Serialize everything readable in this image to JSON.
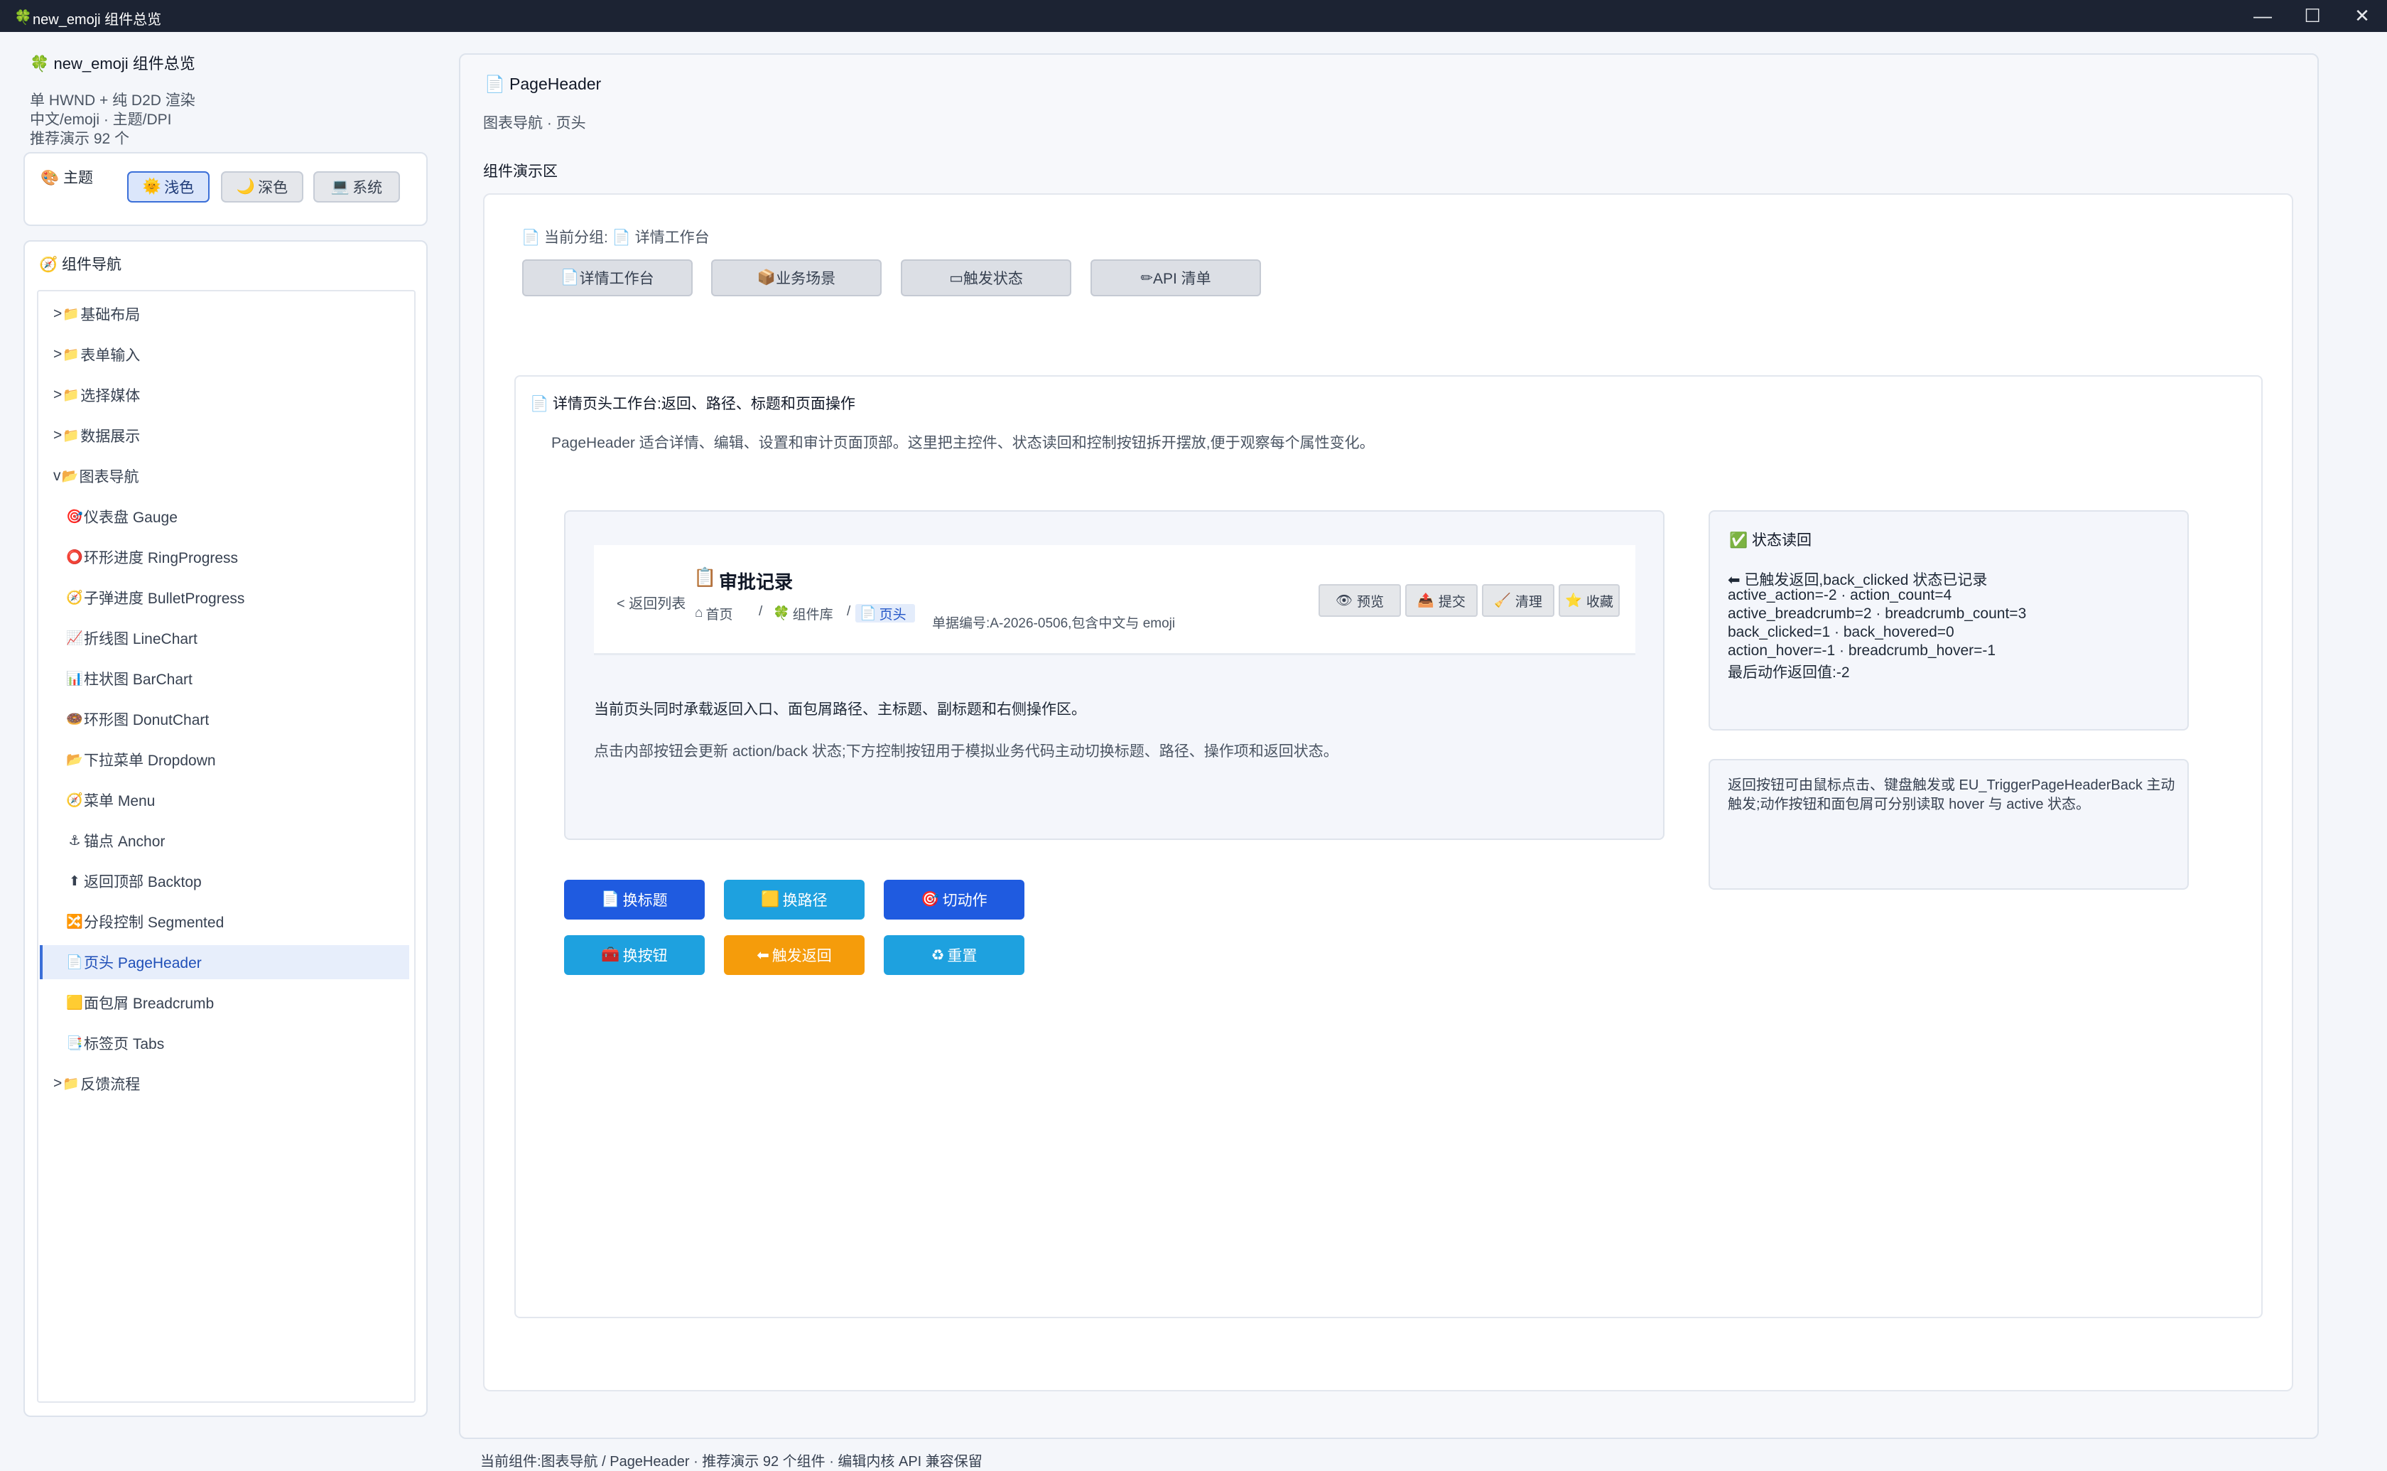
{
  "window": {
    "title": "new_emoji 组件总览",
    "icon": "🍀",
    "controls": {
      "minimize": "—",
      "maximize": "☐",
      "close": "✕"
    }
  },
  "sidebar": {
    "title": "new_emoji 组件总览",
    "title_icon": "🍀",
    "info": [
      "单 HWND + 纯 D2D 渲染",
      "中文/emoji · 主题/DPI",
      "推荐演示 92 个"
    ],
    "theme": {
      "label": "主题",
      "icon": "🎨",
      "options": [
        {
          "icon": "🌞",
          "label": "浅色",
          "active": true
        },
        {
          "icon": "🌙",
          "label": "深色",
          "active": false
        },
        {
          "icon": "💻",
          "label": "系统",
          "active": false
        }
      ]
    },
    "nav": {
      "label": "组件导航",
      "icon": "🧭",
      "items": [
        {
          "prefix": ">",
          "icon": "📁",
          "label": "基础布局",
          "type": "cat"
        },
        {
          "prefix": ">",
          "icon": "📁",
          "label": "表单输入",
          "type": "cat"
        },
        {
          "prefix": ">",
          "icon": "📁",
          "label": "选择媒体",
          "type": "cat"
        },
        {
          "prefix": ">",
          "icon": "📁",
          "label": "数据展示",
          "type": "cat"
        },
        {
          "prefix": "v",
          "icon": "📂",
          "label": "图表导航",
          "type": "cat"
        },
        {
          "prefix": "",
          "icon": "🎯",
          "label": "仪表盘 Gauge",
          "type": "sub"
        },
        {
          "prefix": "",
          "icon": "⭕",
          "label": "环形进度 RingProgress",
          "type": "sub"
        },
        {
          "prefix": "",
          "icon": "🧭",
          "label": "子弹进度 BulletProgress",
          "type": "sub"
        },
        {
          "prefix": "",
          "icon": "📈",
          "label": "折线图 LineChart",
          "type": "sub"
        },
        {
          "prefix": "",
          "icon": "📊",
          "label": "柱状图 BarChart",
          "type": "sub"
        },
        {
          "prefix": "",
          "icon": "🍩",
          "label": "环形图 DonutChart",
          "type": "sub"
        },
        {
          "prefix": "",
          "icon": "📂",
          "label": "下拉菜单 Dropdown",
          "type": "sub"
        },
        {
          "prefix": "",
          "icon": "🧭",
          "label": "菜单 Menu",
          "type": "sub"
        },
        {
          "prefix": "",
          "icon": "⚓",
          "label": "锚点 Anchor",
          "type": "sub"
        },
        {
          "prefix": "",
          "icon": "⬆",
          "label": "返回顶部 Backtop",
          "type": "sub"
        },
        {
          "prefix": "",
          "icon": "🔀",
          "label": "分段控制 Segmented",
          "type": "sub"
        },
        {
          "prefix": "",
          "icon": "📄",
          "label": "页头 PageHeader",
          "type": "sub",
          "selected": true
        },
        {
          "prefix": "",
          "icon": "🟨",
          "label": "面包屑 Breadcrumb",
          "type": "sub"
        },
        {
          "prefix": "",
          "icon": "📑",
          "label": "标签页 Tabs",
          "type": "sub"
        },
        {
          "prefix": ">",
          "icon": "📁",
          "label": "反馈流程",
          "type": "cat"
        }
      ]
    }
  },
  "main": {
    "title": "PageHeader",
    "title_icon": "📄",
    "subtitle": "图表导航 · 页头",
    "demo_label": "组件演示区",
    "current_group_label": "当前分组:",
    "current_group_icon": "📄",
    "current_group_value": "详情工作台",
    "group_buttons": [
      {
        "icon": "📄",
        "label": "详情工作台"
      },
      {
        "icon": "📦",
        "label": "业务场景"
      },
      {
        "icon": "▭",
        "label": "触发状态"
      },
      {
        "icon": "✏",
        "label": "API 清单"
      }
    ],
    "workbench": {
      "icon": "📄",
      "title": "详情页头工作台:返回、路径、标题和页面操作",
      "desc": "PageHeader 适合详情、编辑、设置和审计页面顶部。这里把主控件、状态读回和控制按钮拆开摆放,便于观察每个属性变化。"
    },
    "widget": {
      "back": "< 返回列表",
      "title_icon": "📋",
      "title": "审批记录",
      "breadcrumb": [
        {
          "icon": "⌂",
          "label": "首页"
        },
        {
          "icon": "🍀",
          "label": "组件库"
        },
        {
          "icon": "📄",
          "label": "页头"
        }
      ],
      "separator": "/",
      "subtitle": "单据编号:A-2026-0506,包含中文与 emoji",
      "actions": [
        {
          "icon": "👁",
          "label": "预览"
        },
        {
          "icon": "📤",
          "label": "提交"
        },
        {
          "icon": "🧹",
          "label": "清理"
        },
        {
          "icon": "⭐",
          "label": "收藏"
        }
      ]
    },
    "preview_text": [
      "当前页头同时承载返回入口、面包屑路径、主标题、副标题和右侧操作区。",
      "点击内部按钮会更新 action/back 状态;下方控制按钮用于模拟业务代码主动切换标题、路径、操作项和返回状态。"
    ],
    "controls": [
      {
        "icon": "📄",
        "label": "换标题",
        "color": "#1f5be0"
      },
      {
        "icon": "🟨",
        "label": "换路径",
        "color": "#1ea1df"
      },
      {
        "icon": "🎯",
        "label": "切动作",
        "color": "#1f5be0"
      },
      {
        "icon": "🧰",
        "label": "换按钮",
        "color": "#1ea1df"
      },
      {
        "icon": "⬅",
        "label": "触发返回",
        "color": "#f59c0b"
      },
      {
        "icon": "♻",
        "label": "重置",
        "color": "#1ea1df"
      }
    ],
    "status": {
      "icon": "✅",
      "title": "状态读回",
      "lines": [
        "⬅ 已触发返回,back_clicked 状态已记录",
        "active_action=-2 · action_count=4",
        "active_breadcrumb=2 · breadcrumb_count=3",
        "back_clicked=1 · back_hovered=0",
        "action_hover=-1 · breadcrumb_hover=-1",
        "最后动作返回值:-2"
      ]
    },
    "note": "返回按钮可由鼠标点击、键盘触发或 EU_TriggerPageHeaderBack 主动触发;动作按钮和面包屑可分别读取 hover 与 active 状态。"
  },
  "footer": "当前组件:图表导航 / PageHeader · 推荐演示 92 个组件 · 编辑内核 API 兼容保留"
}
